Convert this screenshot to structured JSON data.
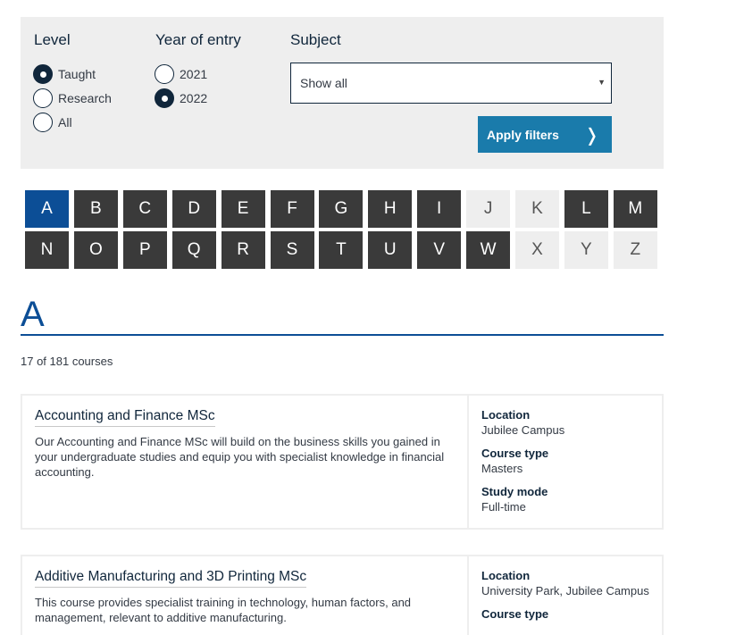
{
  "filters": {
    "level": {
      "title": "Level",
      "options": [
        {
          "label": "Taught",
          "checked": true
        },
        {
          "label": "Research",
          "checked": false
        },
        {
          "label": "All",
          "checked": false
        }
      ]
    },
    "year": {
      "title": "Year of entry",
      "options": [
        {
          "label": "2021",
          "checked": false
        },
        {
          "label": "2022",
          "checked": true
        }
      ]
    },
    "subject": {
      "title": "Subject",
      "selected": "Show all"
    },
    "apply_label": "Apply filters"
  },
  "alphabet": {
    "letters": [
      "A",
      "B",
      "C",
      "D",
      "E",
      "F",
      "G",
      "H",
      "I",
      "J",
      "K",
      "L",
      "M",
      "N",
      "O",
      "P",
      "Q",
      "R",
      "S",
      "T",
      "U",
      "V",
      "W",
      "X",
      "Y",
      "Z"
    ],
    "active": "A",
    "disabled": [
      "J",
      "K",
      "X",
      "Y",
      "Z"
    ]
  },
  "section": {
    "letter": "A",
    "count_text": "17 of 181 courses"
  },
  "courses": [
    {
      "title": "Accounting and Finance MSc",
      "description": "Our Accounting and Finance MSc will build on the business skills you gained in your undergraduate studies and equip you with specialist knowledge in financial accounting.",
      "location_label": "Location",
      "location": "Jubilee Campus",
      "type_label": "Course type",
      "type": "Masters",
      "mode_label": "Study mode",
      "mode": "Full-time"
    },
    {
      "title": "Additive Manufacturing and 3D Printing MSc",
      "description": "This course provides specialist training in technology, human factors, and management, relevant to additive manufacturing.",
      "location_label": "Location",
      "location": "University Park, Jubilee Campus",
      "type_label": "Course type",
      "type": "",
      "mode_label": "",
      "mode": ""
    }
  ]
}
